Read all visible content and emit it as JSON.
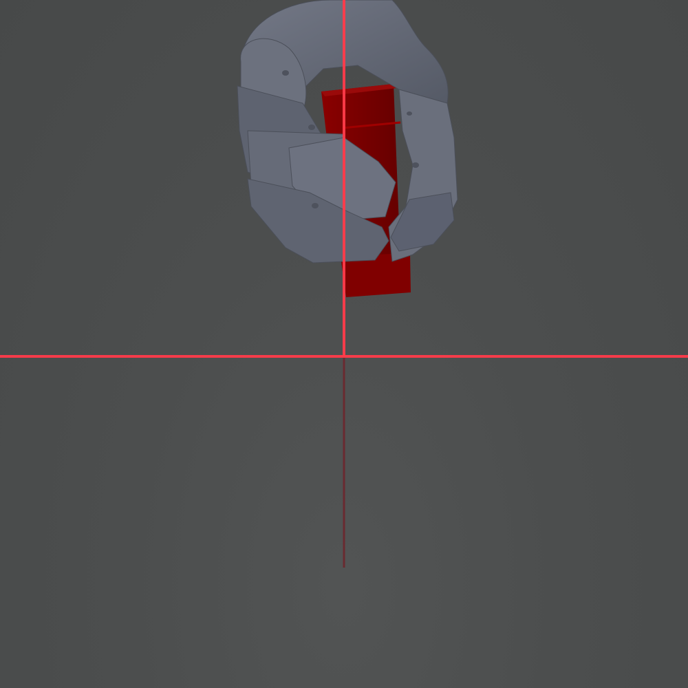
{
  "scene": {
    "background_color": "#4a4c4c",
    "object_color": "#7a0000",
    "gripper_color": "#636875",
    "crosshair_color": "#ff3b4a",
    "depth_line_color": "#6a2a30"
  },
  "icons": {
    "crosshair": "crosshair-icon"
  }
}
